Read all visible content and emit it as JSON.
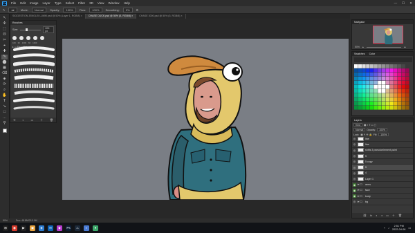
{
  "app": {
    "logo": "Ps"
  },
  "menu": [
    "File",
    "Edit",
    "Image",
    "Layer",
    "Type",
    "Select",
    "Filter",
    "3D",
    "View",
    "Window",
    "Help"
  ],
  "window_controls": [
    "—",
    "☐",
    "✕"
  ],
  "options_bar": {
    "mode_label": "Mode:",
    "mode_value": "Normal",
    "opacity_label": "Opacity:",
    "opacity_value": "100%",
    "flow_label": "Flow:",
    "flow_value": "100%",
    "smoothing_label": "Smoothing:",
    "smoothing_value": "0%"
  },
  "tabs": [
    {
      "label": "SIGGESTION JENGLEI LUMM.psd @ 50% (Layer 1, RGB/8) ×",
      "active": false
    },
    {
      "label": "CHASE DUCK.psd @ 50% (5, RGB/8) ×",
      "active": true
    },
    {
      "label": "CHASE 3000.psd @ 50% (5, RGB/8) ×",
      "active": false
    }
  ],
  "tools": [
    "↖",
    "✣",
    "⬚",
    "ʘ",
    "✂",
    "⌖",
    "✚",
    "✎",
    "⬤",
    "▦",
    "⌫",
    "◈",
    "⟳",
    "⌕",
    "✋",
    "T",
    "↘",
    "□",
    "…",
    "⚲"
  ],
  "status": {
    "zoom": "50%",
    "doc": "Doc: 48.8M/213.1M"
  },
  "brushes_panel": {
    "title": "Brushes",
    "size_label": "Size:",
    "size_value": "200 px",
    "presets": [
      "100",
      "30",
      "1000",
      "60",
      "1000"
    ],
    "folder": "▸ ▭ Favorites",
    "footer": [
      "⟲",
      "◐",
      "▭",
      "＋",
      "🗑"
    ]
  },
  "navigator": {
    "title": "Navigator",
    "zoom": "50%"
  },
  "swatches": {
    "title": "Swatches",
    "tab2": "Color"
  },
  "layers_panel": {
    "title": "Layers",
    "search_label": "Kind",
    "blend": "Normal",
    "opacity_label": "Opacity:",
    "opacity_value": "100%",
    "fill_label": "Fill:",
    "fill_value": "100%",
    "lock_label": "Lock:",
    "layers": [
      {
        "name": "line",
        "type": "layer",
        "visible": false,
        "selected": false
      },
      {
        "name": "line",
        "type": "layer",
        "visible": false,
        "selected": false
      },
      {
        "name": "shifts 3 pseudoelement.paint",
        "type": "layer",
        "visible": false,
        "selected": false
      },
      {
        "name": "5",
        "type": "layer",
        "visible": false,
        "selected": false
      },
      {
        "name": "5 copy",
        "type": "layer",
        "visible": false,
        "selected": false
      },
      {
        "name": "5",
        "type": "layer",
        "visible": false,
        "selected": true
      },
      {
        "name": "4",
        "type": "layer",
        "visible": false,
        "selected": false
      },
      {
        "name": "Layer 1",
        "type": "layer",
        "visible": false,
        "selected": false
      },
      {
        "name": "arms",
        "type": "folder",
        "visible": true,
        "selected": false
      },
      {
        "name": "face",
        "type": "folder",
        "visible": true,
        "selected": false
      },
      {
        "name": "body",
        "type": "folder",
        "visible": true,
        "selected": false
      },
      {
        "name": "bg",
        "type": "folder",
        "visible": false,
        "selected": false
      }
    ],
    "footer": [
      "⛓",
      "fx",
      "◐",
      "◑",
      "▭",
      "＋",
      "🗑"
    ]
  },
  "taskbar": {
    "apps": [
      {
        "glyph": "⊞",
        "color": "#1e1e1e"
      },
      {
        "glyph": "◉",
        "color": "#d33a2c"
      },
      {
        "glyph": "▶",
        "color": "#222"
      },
      {
        "glyph": "▣",
        "color": "#e8a33d"
      },
      {
        "glyph": "◈",
        "color": "#2e7dd1"
      },
      {
        "glyph": "✉",
        "color": "#0e62b4"
      },
      {
        "glyph": "◆",
        "color": "#b73ccf"
      },
      {
        "glyph": "Ps",
        "color": "#0b1d33"
      },
      {
        "glyph": "♨",
        "color": "#1b2838"
      },
      {
        "glyph": "◐",
        "color": "#4a7bd3"
      },
      {
        "glyph": "●",
        "color": "#3da86b"
      }
    ],
    "time": "2:51 PM",
    "date": "2022-04-08"
  }
}
